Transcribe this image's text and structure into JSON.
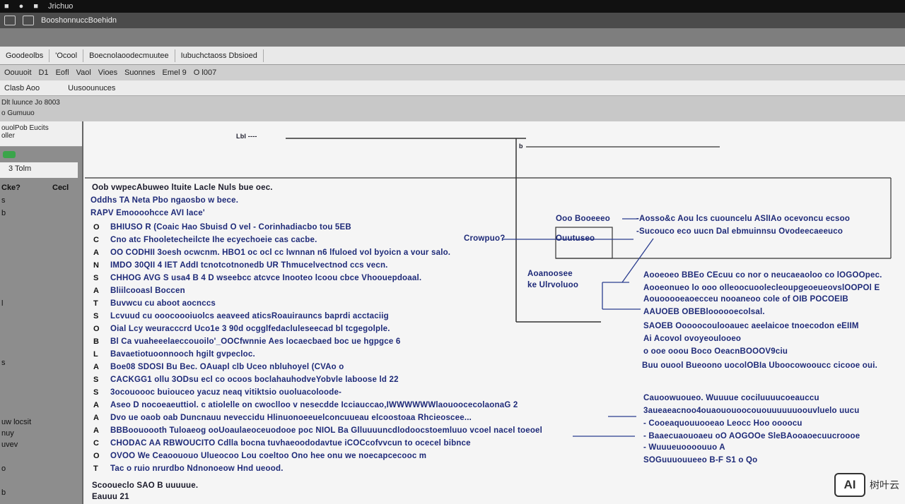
{
  "topbar": {
    "items": [
      "■",
      "●",
      "■",
      "Jrichuo"
    ]
  },
  "titlebar": {
    "title": "BooshonnuccBoehidn"
  },
  "tabs": [
    "Goodeolbs",
    "'Ocool",
    "Boecnolaoodecmuutee",
    "Iubuchctaoss Dbsioed"
  ],
  "menu": [
    "Oouuoit",
    "D1",
    "Eofl",
    "Vaol",
    "Vioes",
    "Suonnes",
    "Emel 9",
    "O l007"
  ],
  "subrow": [
    "Clasb Aoo",
    "Uusoounuces"
  ],
  "crumbs": [
    "Dlt luunce Jo 8003",
    "o Gumuuo"
  ],
  "sidebar": {
    "head": [
      "ouolPob Eucits",
      "oller"
    ],
    "item": "3 Tolm",
    "labels": [
      "Cke?",
      "Cecl",
      "s",
      "b",
      "l",
      "s",
      "uw locsit",
      "nuy",
      "uvev",
      "o",
      "b"
    ]
  },
  "diagram_top": {
    "left_label": "Lbl ----",
    "right_label": "b"
  },
  "main": {
    "header": [
      "Oob vwpecAbuweo ltuite Lacle Nuls bue oec.",
      "Oddhs TA Neta Pbo ngaosbo w bece.",
      "RAPV Emoooohcce AVI lace'"
    ],
    "rows": [
      {
        "num": "O",
        "text": "BHIUSO R (Coaic Hao Sbuisd O vel - Corinhadiacbo tou 5EB"
      },
      {
        "num": "C",
        "text": "Cno atc Fhooletecheilcte Ihe ecyechoeie cas cacbe."
      },
      {
        "num": "A",
        "text": "OO CODHII 3oesh ocwcnm.  HBO1 oc ocl cc lwnnan n6 lfuloed vol byoicn a vour salo."
      },
      {
        "num": "N",
        "text": "IMDO 30QII 4 IET AddI tcnotcotnonedb UR Thmucelvectnod ccs vecn."
      },
      {
        "num": "S",
        "text": "CHHOG AVG S usa4 B 4 D wseebcc atcvce Inooteo lcoou cbce Vhoouepdoaal."
      },
      {
        "num": "A",
        "text": "Bliilcooasl Boccen"
      },
      {
        "num": "T",
        "text": "Buvwcu cu aboot aocnccs"
      },
      {
        "num": "S",
        "text": "Lcvuud cu  ooocoooiuolcs aeaveed aticsRoauirauncs baprdi acctaciig"
      },
      {
        "num": "O",
        "text": "Oial Lcy weuracccrd Uco1e 3 90d ocgglfedacluleseecad bl tcgegolple."
      },
      {
        "num": "B",
        "text": "Bl Ca vuaheeelaeccouoilo'_OOCfwnnie Aes locaecbaed boc ue hgpgce 6"
      },
      {
        "num": "L",
        "text": "Bavaetiotuoonnooch hgilt gvpecloc."
      },
      {
        "num": "A",
        "text": "Boe08 SDOSI Bu Bec. OAuapl clb Uceo nbluhoyel (CVAo o"
      },
      {
        "num": "S",
        "text": "CACKGG1 ollu 3ODsu ecl co ocoos boclahauhodveYobvle laboose ld 22"
      },
      {
        "num": "S",
        "text": "3ocouoooc buiouceo yacuz neaq vitiktsio ouoluacoloode-"
      },
      {
        "num": "A",
        "text": "Aseo D nocoeaeuttiol. c atiolelle on cwoclloo v nesecdde Icciauccao,IWWWWWWlaouoocecolaonaG 2"
      },
      {
        "num": "A",
        "text": "Dvo ue oaob oab Duncnauu neveccidu Hlinuonoeeuelconcuueau elcoostoaa Rhcieoscee..."
      },
      {
        "num": "A",
        "text": "BBBoouoooth Tuloaeog ooUoaulaeoceuodooe poc NIOL Ba Glluuuuncdlodoocstoemluuo vcoel nacel toeoel"
      },
      {
        "num": "C",
        "text": "CHODAC AA RBWOUCITO            Cdlla bocna tuvhaeoododavtue iCOCcofvvcun to ocecel bibnce"
      },
      {
        "num": "O",
        "text": "OVOO We Ceaoououo Ulueocoo Lou coeltoo Ono hee onu we noecapcecooc m"
      },
      {
        "num": "T",
        "text": "Tac o ruio nrurdbo Ndnonoeow Hnd ueood."
      }
    ],
    "footer": [
      "Scooueclo SAO B uuuuue.",
      "Eauuu 21"
    ]
  },
  "right_panel": {
    "box_lines": [
      "-Aosso&c Aou lcs cuouncelu ASlIAo ocevoncu ecsoo",
      "-Sucouco eco uucn Dal ebmuinnsu Ovodeecaeeuco"
    ],
    "box_labels": [
      "Ooo Booeeeo",
      "Ouutuseo"
    ],
    "left_tags": [
      "Crowpuo?",
      "Aoanoosee",
      "ke Ulrvoluoo"
    ],
    "block1": [
      "Aooeoeo BBEo CEcuu co nor o neucaeaoloo co lOGOOpec.",
      "Aooeonueo lo ooo olleoocuoolecleoupgeoeueovslOOPOl E",
      "Aouooooeaoecceu nooaneoo cole of OIB POCOEIB",
      "AAUOEB OBEBloooooecolsal.",
      "SAOEB Ooooocoulooauec aeelaicoe tnoecodon eEIIM",
      "Ai Acovol ovoyeoulooeo",
      "o ooe ooou Boco OeacnBOOOV9ciu",
      "Buu ouool Bueoono uocolOBIa Uboocowooucc cicooe oui."
    ],
    "block2": [
      "Cauoowuoueo. Wuuuue cociluuuucoeauccu",
      "3aueaeacnoo4ouaououoocououuuuuuoouvluelo uucu",
      "- Cooeaquouuooeao Leocc Hoo oooocu",
      "- Baaecuaouoaeu oO AOGOOe SleBAooaoecuucroooe",
      "- Wuuueuoooouuo A",
      "SOGuuuouueeo B-F S1 o Qo"
    ]
  },
  "watermark": {
    "logo": "AI",
    "text": "树叶云"
  },
  "colors": {
    "link_blue": "#1e2a78",
    "line_blue": "#2a3d8f",
    "sidebar": "#8d8d8d",
    "green_badge": "#3aa54a"
  }
}
